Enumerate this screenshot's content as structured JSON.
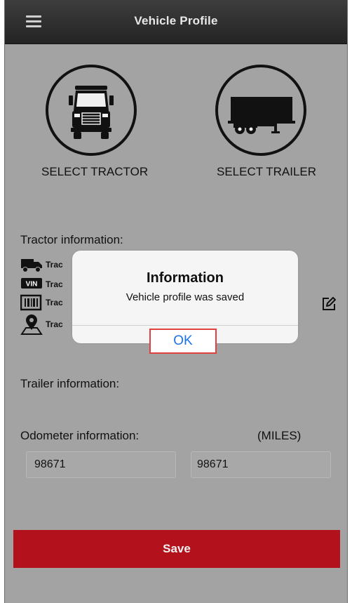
{
  "header": {
    "title": "Vehicle Profile",
    "menu_icon": "hamburger-menu-icon"
  },
  "selectors": {
    "tractor": {
      "label": "SELECT TRACTOR",
      "icon": "truck-front-icon"
    },
    "trailer": {
      "label": "SELECT TRAILER",
      "icon": "trailer-side-icon"
    }
  },
  "tractor_info": {
    "label": "Tractor information:",
    "rows": [
      {
        "icon": "truck-icon",
        "text": "Trac"
      },
      {
        "icon": "vin-icon",
        "text": "Trac"
      },
      {
        "icon": "barcode-icon",
        "text": "Trac"
      },
      {
        "icon": "location-pin-icon",
        "text": "Trac"
      }
    ],
    "edit_icon": "edit-icon"
  },
  "trailer_info": {
    "label": "Trailer information:"
  },
  "odometer": {
    "label": "Odometer information:",
    "units": "(MILES)",
    "value_1": "98671",
    "value_2": "98671"
  },
  "save_label": "Save",
  "dialog": {
    "title": "Information",
    "message": "Vehicle profile was saved",
    "ok_label": "OK"
  },
  "colors": {
    "header": "#2e2e2e",
    "background": "#a3a3a3",
    "save_button": "#b3121c",
    "ok_text": "#1a73e8",
    "ok_highlight": "#e04040"
  }
}
